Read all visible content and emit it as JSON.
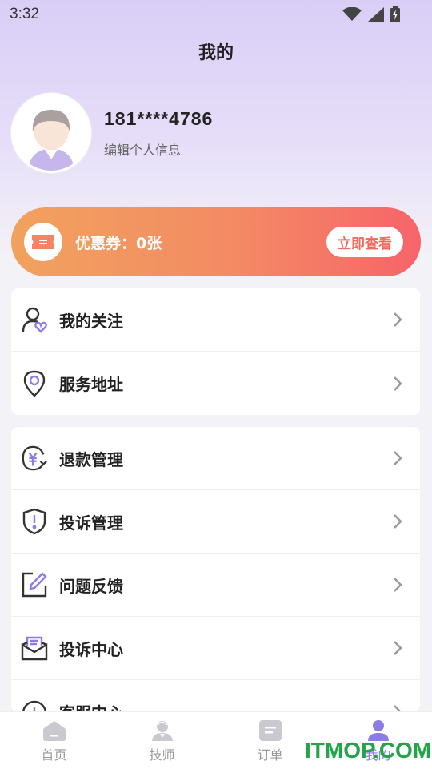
{
  "status_bar": {
    "time": "3:32"
  },
  "header": {
    "title": "我的"
  },
  "profile": {
    "phone": "181****4786",
    "edit_label": "编辑个人信息"
  },
  "coupon": {
    "label": "优惠券：0张",
    "button_label": "立即查看"
  },
  "menu_group_1": [
    {
      "label": "我的关注",
      "icon": "user-heart-icon"
    },
    {
      "label": "服务地址",
      "icon": "location-pin-icon"
    }
  ],
  "menu_group_2": [
    {
      "label": "退款管理",
      "icon": "refund-icon"
    },
    {
      "label": "投诉管理",
      "icon": "shield-alert-icon"
    },
    {
      "label": "问题反馈",
      "icon": "edit-icon"
    },
    {
      "label": "投诉中心",
      "icon": "mail-icon"
    },
    {
      "label": "客服中心",
      "icon": "headset-icon"
    }
  ],
  "tab_bar": [
    {
      "label": "首页",
      "icon": "home-icon",
      "active": false
    },
    {
      "label": "技师",
      "icon": "technician-icon",
      "active": false
    },
    {
      "label": "订单",
      "icon": "order-icon",
      "active": false
    },
    {
      "label": "我的",
      "icon": "profile-icon",
      "active": true
    }
  ],
  "watermark": "ITMOP.COM",
  "colors": {
    "accent": "#8c7ce6",
    "coupon_start": "#f1a25e",
    "coupon_end": "#f7646a",
    "watermark": "#24a44a"
  }
}
